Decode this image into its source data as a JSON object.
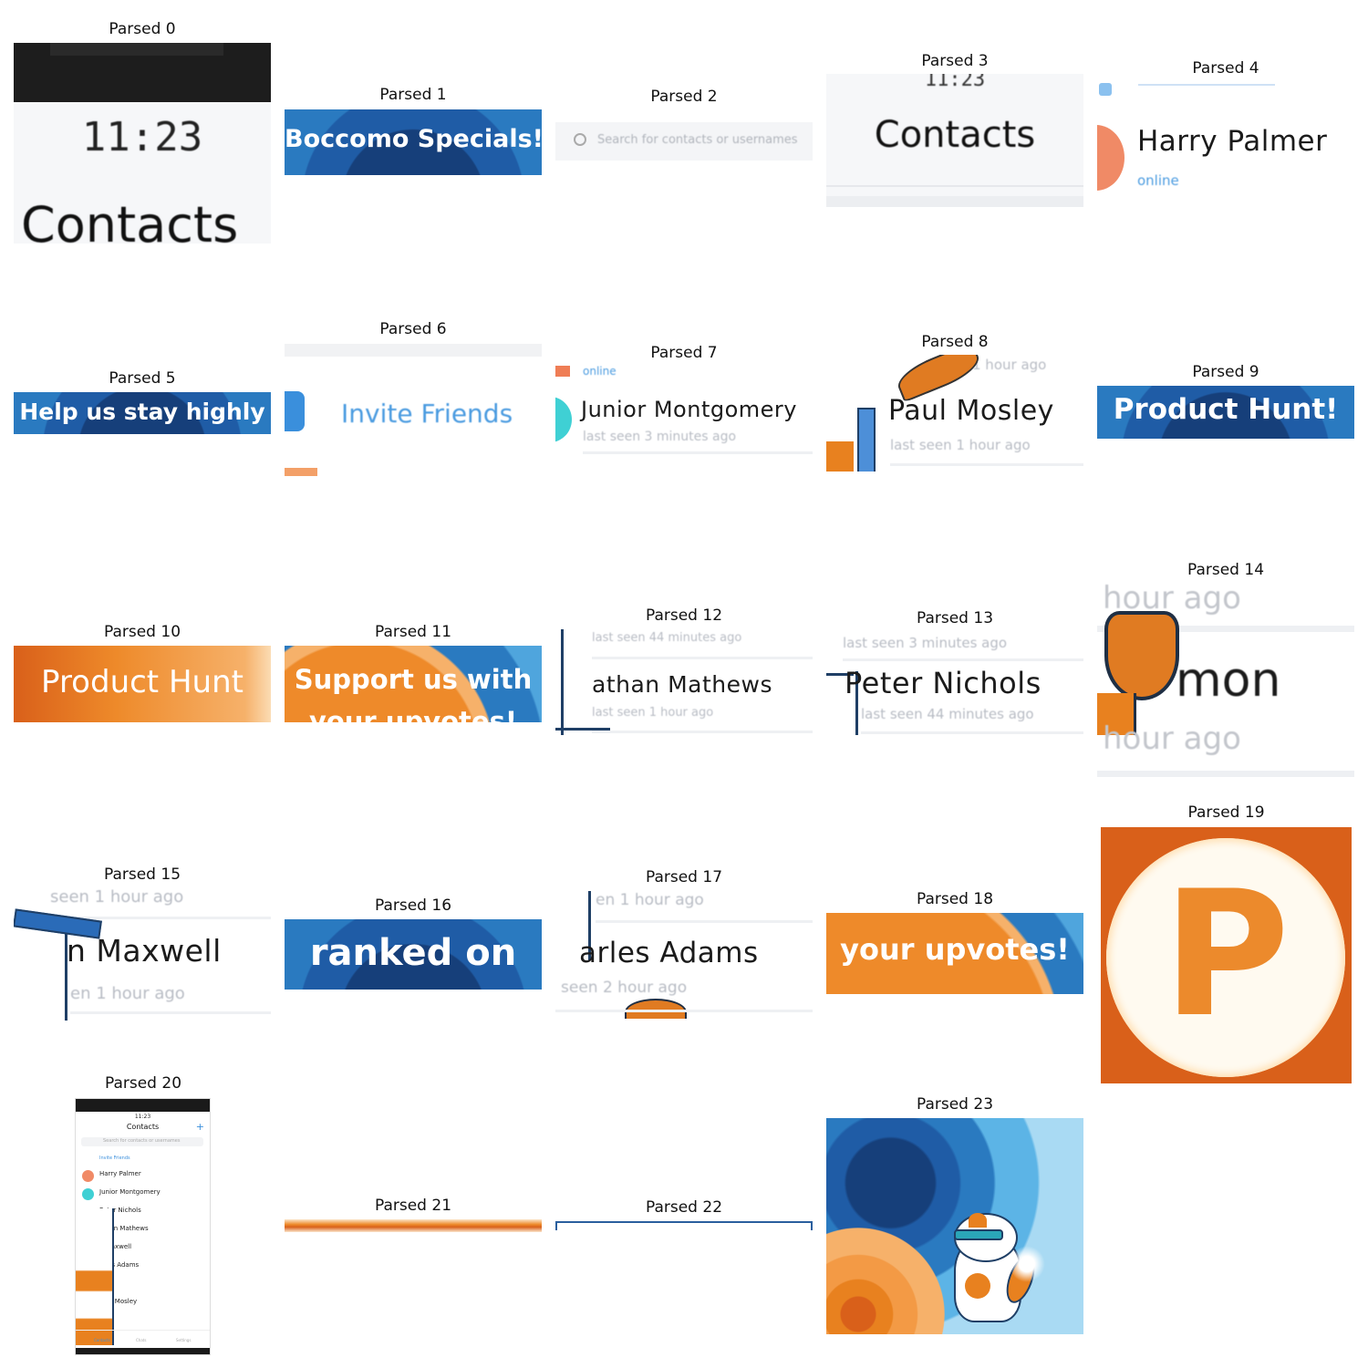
{
  "tiles": {
    "t0": {
      "caption": "Parsed 0",
      "time": "11:23",
      "title": "Contacts"
    },
    "t1": {
      "caption": "Parsed 1",
      "text": "Boccomo Specials!"
    },
    "t2": {
      "caption": "Parsed 2",
      "placeholder": "Search for contacts or usernames"
    },
    "t3": {
      "caption": "Parsed 3",
      "time": "11:23",
      "title": "Contacts"
    },
    "t4": {
      "caption": "Parsed 4",
      "name": "Harry Palmer",
      "status": "online"
    },
    "t5": {
      "caption": "Parsed 5",
      "text": "Help us stay highly"
    },
    "t6": {
      "caption": "Parsed 6",
      "text": "Invite Friends"
    },
    "t7": {
      "caption": "Parsed 7",
      "status_top": "online",
      "name": "Junior Montgomery",
      "status": "last seen 3 minutes ago"
    },
    "t8": {
      "caption": "Parsed 8",
      "top": "1 hour ago",
      "name": "Paul Mosley",
      "status": "last seen 1 hour ago"
    },
    "t9": {
      "caption": "Parsed 9",
      "text": "Product Hunt!"
    },
    "t10": {
      "caption": "Parsed 10",
      "text": "Product Hunt"
    },
    "t11": {
      "caption": "Parsed 11",
      "text": "Support us with",
      "text2": "your upvotes!"
    },
    "t12": {
      "caption": "Parsed 12",
      "top": "last seen 44 minutes ago",
      "name": "athan Mathews",
      "status": "last seen 1 hour ago"
    },
    "t13": {
      "caption": "Parsed 13",
      "top": "last seen 3 minutes ago",
      "name": "Peter Nichols",
      "status": "last seen 44 minutes ago"
    },
    "t14": {
      "caption": "Parsed 14",
      "top": "hour ago",
      "name": "mon",
      "status": "hour ago"
    },
    "t15": {
      "caption": "Parsed 15",
      "top": "seen 1 hour ago",
      "name": "n Maxwell",
      "status": "en 1 hour ago"
    },
    "t16": {
      "caption": "Parsed 16",
      "text": "ranked on"
    },
    "t17": {
      "caption": "Parsed 17",
      "top": "en 1 hour ago",
      "name": "arles Adams",
      "status": "seen 2 hour ago"
    },
    "t18": {
      "caption": "Parsed 18",
      "text": "your upvotes!"
    },
    "t19": {
      "caption": "Parsed 19",
      "letter": "P"
    },
    "t20": {
      "caption": "Parsed 20",
      "time": "11:23",
      "title": "Contacts",
      "search": "Search for contacts or usernames",
      "invite": "Invite Friends",
      "rows": [
        "Harry Palmer",
        "Junior Montgomery",
        "Peter Nichols",
        "athan Mathews",
        "n Maxwell",
        "arles Adams",
        "mon",
        "Paul Mosley"
      ],
      "tabs": [
        "Contacts",
        "Chats",
        "Settings"
      ]
    },
    "t21": {
      "caption": "Parsed 21"
    },
    "t22": {
      "caption": "Parsed 22"
    },
    "t23": {
      "caption": "Parsed 23"
    }
  },
  "colors": {
    "accent_blue": "#2a7ac0",
    "dark_blue": "#163f7a",
    "orange": "#e8811f",
    "light_orange": "#f6b16a"
  }
}
